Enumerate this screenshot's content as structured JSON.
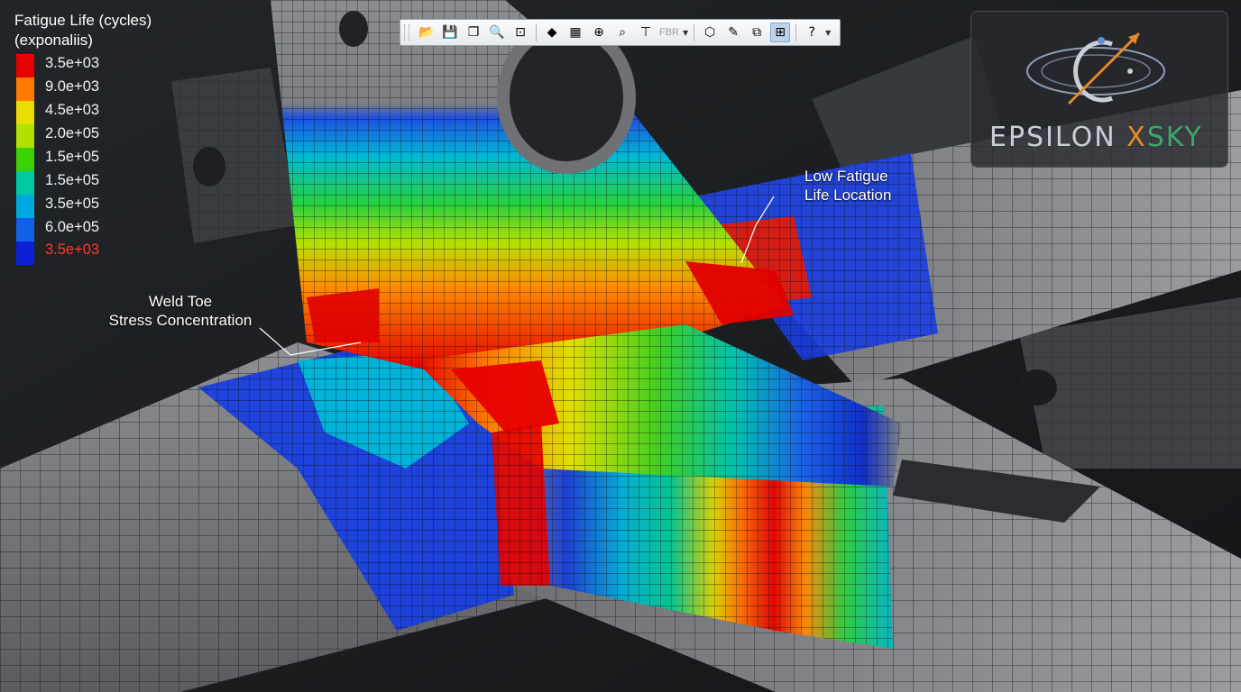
{
  "legend": {
    "title_line1": "Fatigue Life (cycles)",
    "title_line2": "(exponaliis)",
    "entries": [
      {
        "label": "3.5e+03",
        "color": "#e60000"
      },
      {
        "label": "9.0e+03",
        "color": "#ff7a00"
      },
      {
        "label": "4.5e+03",
        "color": "#e8dc00"
      },
      {
        "label": "2.0e+05",
        "color": "#b2e000"
      },
      {
        "label": "1.5e+05",
        "color": "#3ad200"
      },
      {
        "label": "1.5e+05",
        "color": "#00c8a0"
      },
      {
        "label": "3.5e+05",
        "color": "#00a8e0"
      },
      {
        "label": "6.0e+05",
        "color": "#1060e8"
      },
      {
        "label": "",
        "color": "#0b1ed8"
      }
    ],
    "footer_label": "3.5e+03",
    "footer_color": "#ff3a2a"
  },
  "toolbar": {
    "buttons": [
      {
        "name": "open-icon",
        "glyph": "📂"
      },
      {
        "name": "save-icon",
        "glyph": "💾"
      },
      {
        "name": "copy-icon",
        "glyph": "❐"
      },
      {
        "name": "zoom-icon",
        "glyph": "🔍"
      },
      {
        "name": "zoom-box-icon",
        "glyph": "⊡"
      }
    ],
    "buttons2": [
      {
        "name": "render-mode-icon",
        "glyph": "◆"
      },
      {
        "name": "contour-icon",
        "glyph": "▦"
      },
      {
        "name": "zoom-fit-icon",
        "glyph": "⊕"
      },
      {
        "name": "query-icon",
        "glyph": "⌕"
      },
      {
        "name": "section-icon",
        "glyph": "⊤"
      }
    ],
    "format_text": "FBR",
    "buttons3": [
      {
        "name": "view-iso-icon",
        "glyph": "⬡"
      },
      {
        "name": "probe-icon",
        "glyph": "✎"
      },
      {
        "name": "display-options-icon",
        "glyph": "⧉"
      }
    ],
    "active_button": {
      "name": "mesh-view-icon",
      "glyph": "⊞"
    },
    "help": {
      "name": "help-icon",
      "glyph": "?"
    }
  },
  "callouts": {
    "weld_line1": "Weld Toe",
    "weld_line2": "Stress Concentration",
    "low_line1": "Low Fatigue",
    "low_line2": "Life Location"
  },
  "logo": {
    "word1": "EPSILON ",
    "word2": "X",
    "word3": "SKY",
    "accent_blue": "#5b8fd8",
    "accent_orange": "#e58a2a",
    "accent_green": "#3aa86b"
  }
}
